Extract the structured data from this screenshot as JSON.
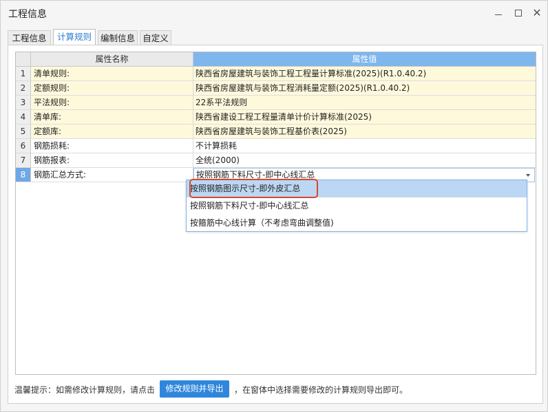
{
  "window": {
    "title": "工程信息"
  },
  "tabs": [
    {
      "label": "工程信息"
    },
    {
      "label": "计算规则"
    },
    {
      "label": "编制信息"
    },
    {
      "label": "自定义"
    }
  ],
  "grid": {
    "header_name": "属性名称",
    "header_value": "属性值",
    "rows": [
      {
        "num": "1",
        "name": "清单规则:",
        "value": "陕西省房屋建筑与装饰工程工程量计算标准(2025)(R1.0.40.2)"
      },
      {
        "num": "2",
        "name": "定额规则:",
        "value": "陕西省房屋建筑与装饰工程消耗量定额(2025)(R1.0.40.2)"
      },
      {
        "num": "3",
        "name": "平法规则:",
        "value": "22系平法规则"
      },
      {
        "num": "4",
        "name": "清单库:",
        "value": "陕西省建设工程工程量清单计价计算标准(2025)"
      },
      {
        "num": "5",
        "name": "定额库:",
        "value": "陕西省房屋建筑与装饰工程基价表(2025)"
      },
      {
        "num": "6",
        "name": "钢筋损耗:",
        "value": "不计算损耗"
      },
      {
        "num": "7",
        "name": "钢筋报表:",
        "value": "全统(2000)"
      },
      {
        "num": "8",
        "name": "钢筋汇总方式:",
        "value": "按照钢筋下料尺寸-即中心线汇总"
      }
    ]
  },
  "dropdown": {
    "options": [
      "按照钢筋图示尺寸-即外皮汇总",
      "按照钢筋下料尺寸-即中心线汇总",
      "按箍筋中心线计算（不考虑弯曲调整值)"
    ]
  },
  "footer": {
    "hint_before": "温馨提示：如需修改计算规则，请点击",
    "button_label": "修改规则并导出",
    "hint_after": "，在窗体中选择需要修改的计算规则导出即可。"
  },
  "colors": {
    "accent": "#2f86dc",
    "header_value_bg": "#7fb6ee",
    "highlight_row": "#fff9dc",
    "selected_option": "#bcd7f3",
    "annotation_red": "#d9472b"
  }
}
